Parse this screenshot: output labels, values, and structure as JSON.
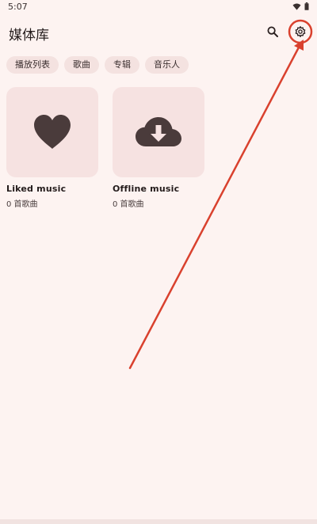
{
  "status_bar": {
    "time": "5:07",
    "icons": [
      "wifi-icon",
      "battery-icon"
    ]
  },
  "header": {
    "title": "媒体库",
    "actions": [
      {
        "name": "search-icon"
      },
      {
        "name": "gear-icon"
      }
    ]
  },
  "filter_chips": [
    "播放列表",
    "歌曲",
    "专辑",
    "音乐人"
  ],
  "library_cards": [
    {
      "title": "Liked music",
      "subtitle": "0 首歌曲",
      "icon": "heart-icon"
    },
    {
      "title": "Offline music",
      "subtitle": "0 首歌曲",
      "icon": "cloud-download-icon"
    }
  ],
  "colors": {
    "background": "#fdf3f1",
    "card_background": "#f6e2e1",
    "chip_background": "#f4e2e0",
    "icon": "#4a3b3b",
    "annotation": "#d9412e"
  }
}
